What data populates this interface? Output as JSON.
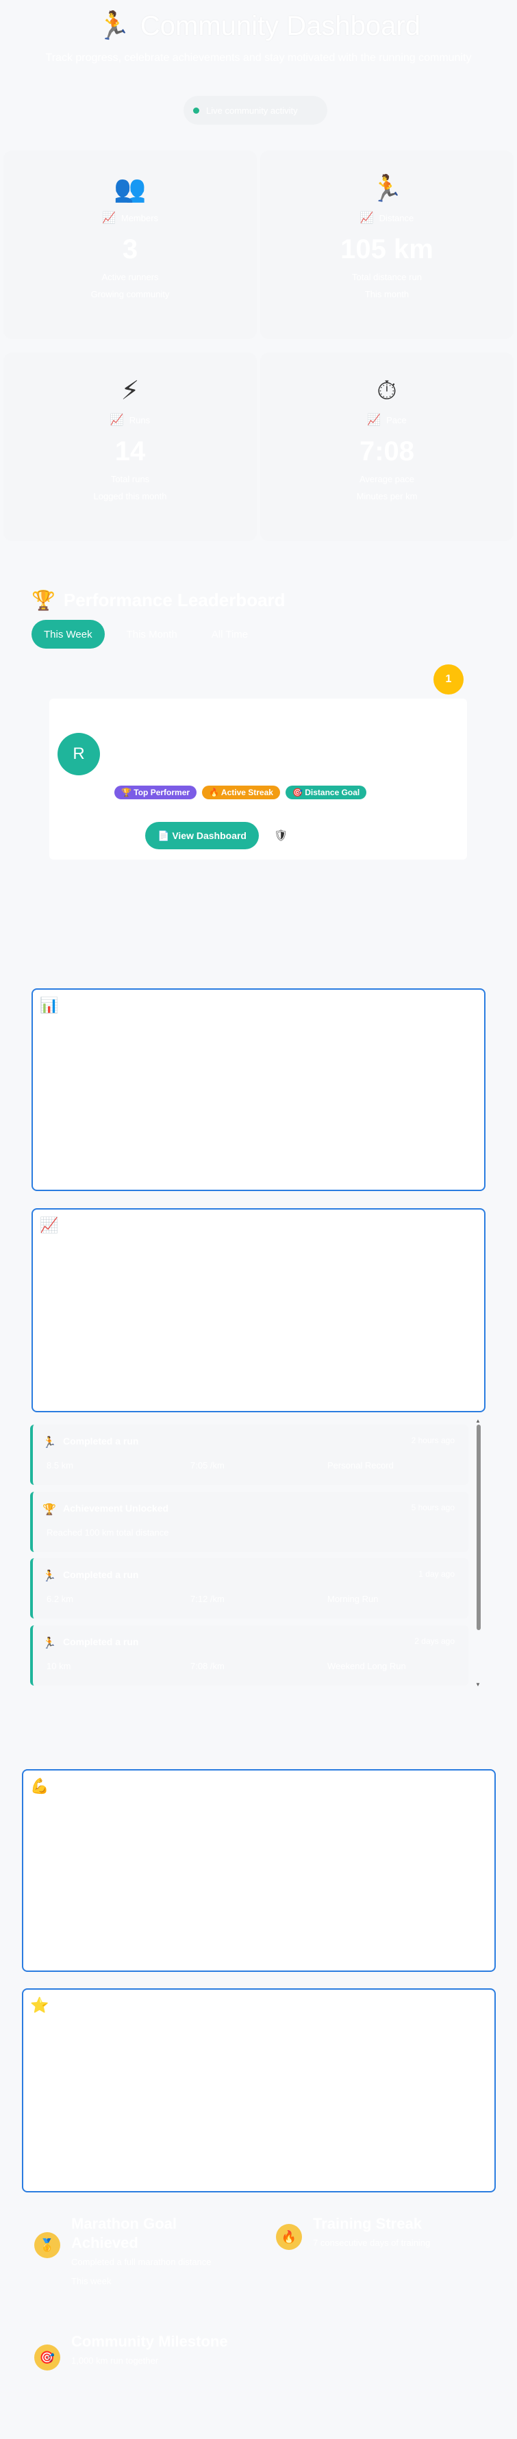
{
  "header": {
    "icon": "runner-icon",
    "title": "Community Dashboard",
    "subtitle": "Track progress, celebrate achievements and stay motivated with the running community",
    "status": "Live community activity"
  },
  "stats": [
    {
      "icon": "people-icon",
      "glyph": "👥",
      "label": "Members",
      "value": "3",
      "sub1": "Active runners",
      "sub2": "Growing community"
    },
    {
      "icon": "runner-icon",
      "glyph": "🏃",
      "label": "Distance",
      "value": "105 km",
      "sub1": "Total distance run",
      "sub2": "This month"
    },
    {
      "icon": "lightning-icon",
      "glyph": "⚡",
      "label": "Runs",
      "value": "14",
      "sub1": "Total runs",
      "sub2": "Logged this month"
    },
    {
      "icon": "stopwatch-icon",
      "glyph": "⏱",
      "label": "Pace",
      "value": "7:08",
      "sub1": "Average pace",
      "sub2": "Minutes per km"
    }
  ],
  "leaderboard": {
    "title": "Performance Leaderboard",
    "tabs": [
      {
        "label": "This Week",
        "active": true
      },
      {
        "label": "This Month",
        "active": false
      },
      {
        "label": "All Time",
        "active": false
      }
    ],
    "rank": "1",
    "avatar_initial": "R",
    "badges": [
      {
        "label": "🏆 Top Performer",
        "color": "#7b5ce6"
      },
      {
        "label": "🔥 Active Streak",
        "color": "#f39c12"
      },
      {
        "label": "🎯 Distance Goal",
        "color": "#1fb59b"
      }
    ],
    "view_button": "📄 View Dashboard"
  },
  "panels": [
    {
      "icon": "bar-chart-icon",
      "glyph": "📊"
    },
    {
      "icon": "line-chart-icon",
      "glyph": "📈"
    },
    {
      "icon": "flexed-biceps-icon",
      "glyph": "💪"
    },
    {
      "icon": "star-icon",
      "glyph": "⭐"
    }
  ],
  "feed": [
    {
      "icon": "runner-icon",
      "glyph": "🏃",
      "title": "Completed a run",
      "time": "2 hours ago",
      "c1": "8.5 km",
      "c2": "7:05 /km",
      "c3": "Personal Record"
    },
    {
      "icon": "trophy-icon",
      "glyph": "🏆",
      "title": "Achievement Unlocked",
      "time": "5 hours ago",
      "c1": "Reached 100 km total distance",
      "c2": "",
      "c3": ""
    },
    {
      "icon": "runner-icon",
      "glyph": "🏃",
      "title": "Completed a run",
      "time": "1 day ago",
      "c1": "6.2 km",
      "c2": "7:12 /km",
      "c3": "Morning Run"
    },
    {
      "icon": "runner-icon",
      "glyph": "🏃",
      "title": "Completed a run",
      "time": "2 days ago",
      "c1": "10 km",
      "c2": "7:08 /km",
      "c3": "Weekend Long Run"
    }
  ],
  "achievements": [
    {
      "icon": "medal-icon",
      "glyph": "🥇",
      "title": "Marathon Goal Achieved",
      "desc": "Completed a full marathon distance",
      "date": "This week"
    },
    {
      "icon": "fire-icon",
      "glyph": "🔥",
      "title": "Training Streak",
      "desc": "7 consecutive days of training",
      "date": ""
    },
    {
      "icon": "target-icon",
      "glyph": "🎯",
      "title": "Community Milestone",
      "desc": "1,000 km run together",
      "date": ""
    }
  ]
}
